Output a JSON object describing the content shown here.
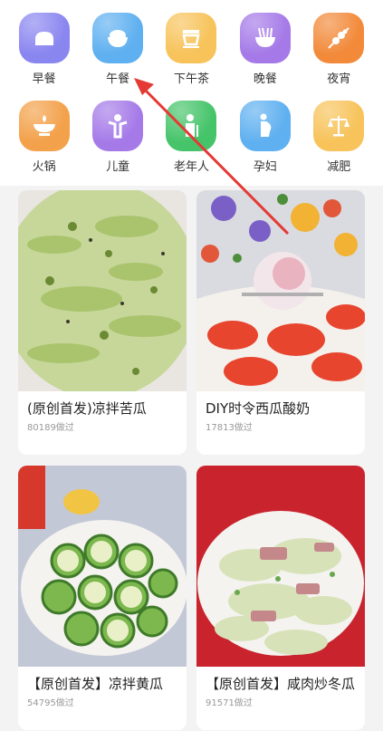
{
  "categories": [
    {
      "label": "早餐",
      "icon": "bread-icon",
      "color": "#8a86f0"
    },
    {
      "label": "午餐",
      "icon": "rice-bowl-icon",
      "color": "#5fb0f0"
    },
    {
      "label": "下午茶",
      "icon": "teacup-icon",
      "color": "#f7c35a"
    },
    {
      "label": "晚餐",
      "icon": "noodle-bowl-icon",
      "color": "#a57ae8"
    },
    {
      "label": "夜宵",
      "icon": "skewer-icon",
      "color": "#f28a3a"
    },
    {
      "label": "火锅",
      "icon": "hotpot-icon",
      "color": "#f3a14a"
    },
    {
      "label": "儿童",
      "icon": "child-icon",
      "color": "#a57ae8"
    },
    {
      "label": "老年人",
      "icon": "elder-icon",
      "color": "#46c46a"
    },
    {
      "label": "孕妇",
      "icon": "pregnant-icon",
      "color": "#5fb0f0"
    },
    {
      "label": "减肥",
      "icon": "scale-icon",
      "color": "#f7c35a"
    }
  ],
  "recipes": [
    {
      "title": "(原创首发)凉拌苦瓜",
      "meta": "80189做过"
    },
    {
      "title": "DIY时令西瓜酸奶",
      "meta": "17813做过"
    },
    {
      "title": "【原创首发】凉拌黄瓜",
      "meta": "54795做过"
    },
    {
      "title": "【原创首发】咸肉炒冬瓜",
      "meta": "91571做过"
    }
  ],
  "annotation": {
    "arrow_color": "#e53935"
  }
}
